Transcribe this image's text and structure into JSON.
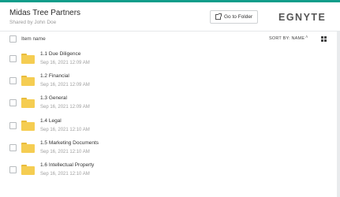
{
  "header": {
    "title": "Midas Tree Partners",
    "subtitle": "Shared by John Doe",
    "goto_label": "Go to Folder",
    "logo_text": "EGNYTE",
    "accent_color": "#0f9d8a"
  },
  "columns": {
    "name_label": "Item name",
    "sort_label": "SORT BY: NAME",
    "sort_arrow": "˄"
  },
  "items": [
    {
      "name": "1.1 Due Diligence",
      "date": "Sep 16, 2021 12:09 AM",
      "icon": "folder-icon"
    },
    {
      "name": "1.2 Financial",
      "date": "Sep 16, 2021 12:09 AM",
      "icon": "folder-icon"
    },
    {
      "name": "1.3 General",
      "date": "Sep 16, 2021 12:09 AM",
      "icon": "folder-icon"
    },
    {
      "name": "1.4 Legal",
      "date": "Sep 16, 2021 12:10 AM",
      "icon": "folder-icon"
    },
    {
      "name": "1.5 Marketing Documents",
      "date": "Sep 16, 2021 12:10 AM",
      "icon": "folder-icon"
    },
    {
      "name": "1.6 Intellectual Property",
      "date": "Sep 16, 2021 12:10 AM",
      "icon": "folder-icon"
    }
  ]
}
